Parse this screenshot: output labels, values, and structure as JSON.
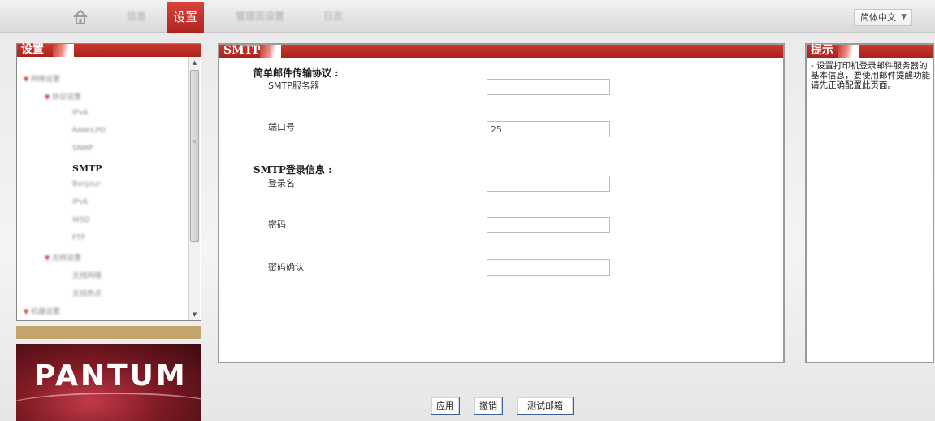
{
  "nav": {
    "tabs": [
      {
        "label": "信息"
      },
      {
        "label": "设置"
      },
      {
        "label": "管理员设置"
      },
      {
        "label": "日志"
      }
    ],
    "language": "简体中文"
  },
  "settings_panel": {
    "title": "设置",
    "current_item": "SMTP",
    "blurred_items": [
      "网络设置",
      "协议设置",
      "IPv4",
      "RAW/LPD",
      "SNMP",
      "Bonjour",
      "IPv6",
      "WSD",
      "FTP",
      "无线设置",
      "无线网络",
      "无线热点",
      "机器设置"
    ]
  },
  "main": {
    "title": "SMTP",
    "smtp_section": "简单邮件传输协议 :",
    "smtp_server_label": "SMTP服务器",
    "smtp_server_value": "",
    "port_label": "端口号",
    "port_value": "25",
    "login_section": "SMTP登录信息 :",
    "login_name_label": "登录名",
    "login_name_value": "",
    "password_label": "密码",
    "password_value": "",
    "password_confirm_label": "密码确认",
    "password_confirm_value": ""
  },
  "help": {
    "title": "提示",
    "text": "- 设置打印机登录邮件服务器的基本信息，要使用邮件提醒功能请先正确配置此页面。"
  },
  "buttons": {
    "apply": "应用",
    "cancel": "撤销",
    "test_mail": "测试邮箱"
  },
  "brand": {
    "logo_text": "PANTUM"
  },
  "colors": {
    "accent_red": "#b7271f",
    "gold_bar": "#c4a56c",
    "button_border": "#3f5f9a"
  }
}
